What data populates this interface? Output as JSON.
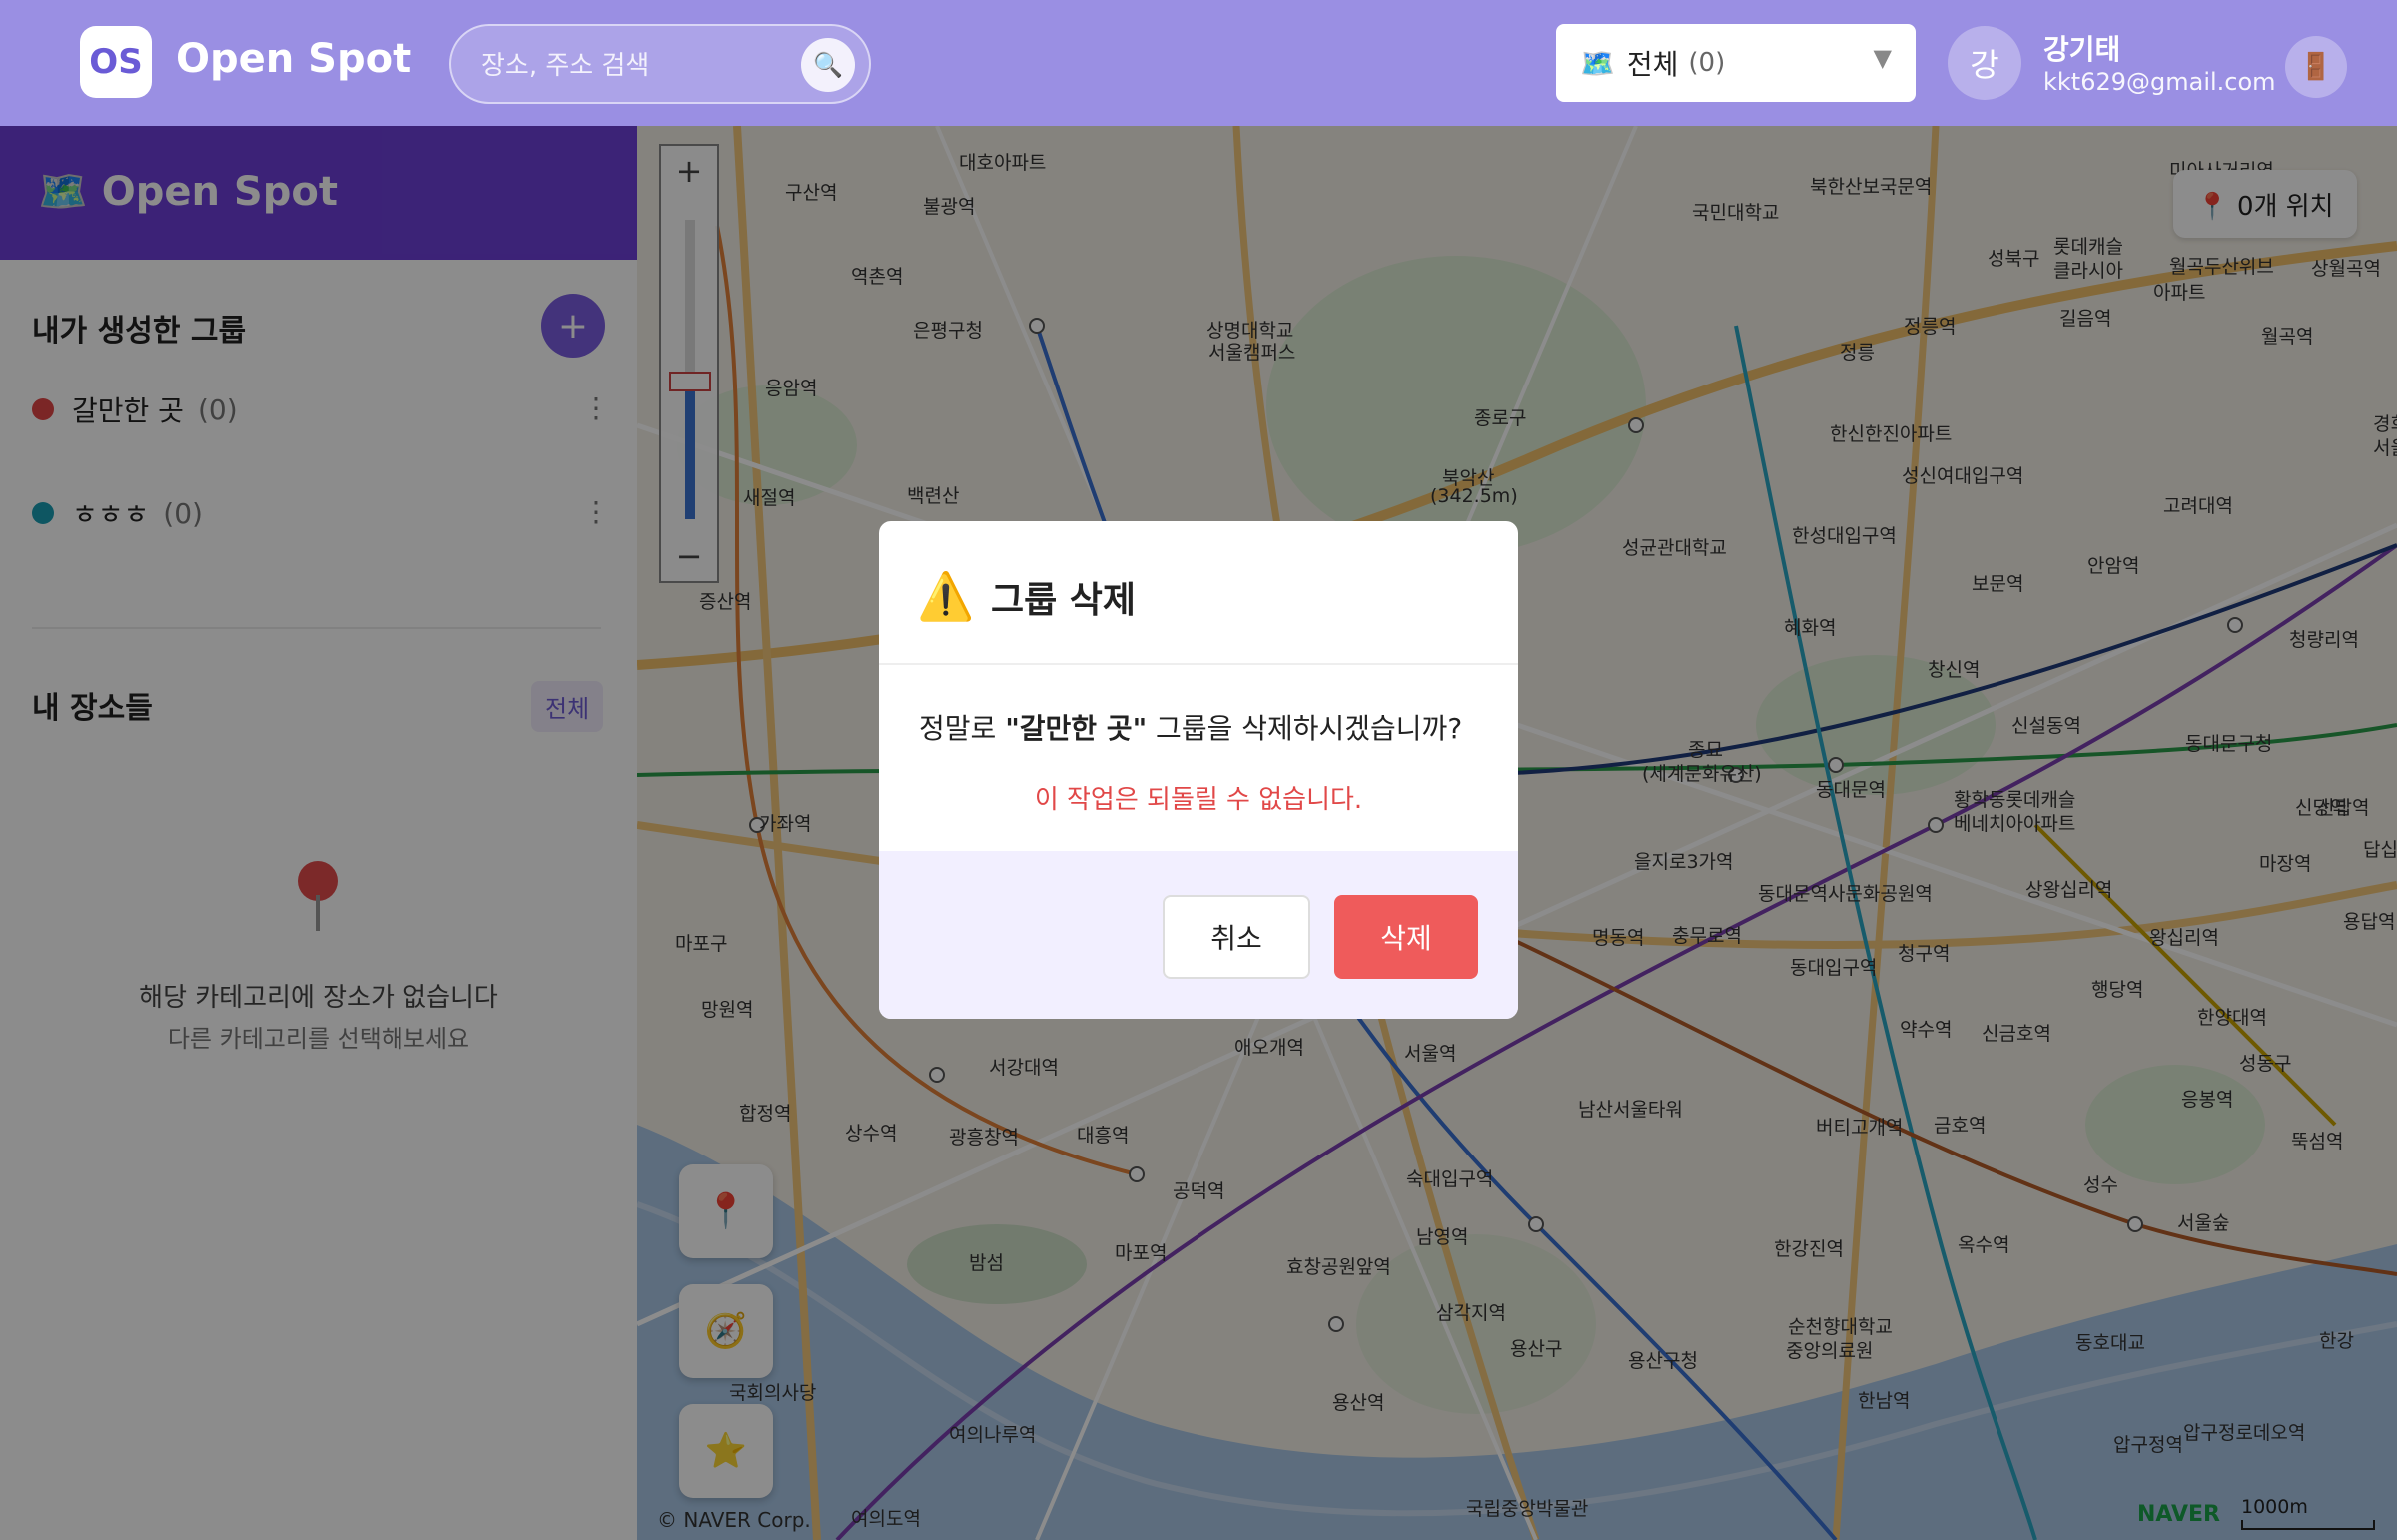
{
  "header": {
    "logo_badge": "OS",
    "app_name": "Open Spot",
    "search_placeholder": "장소, 주소 검색",
    "search_icon": "🔍",
    "category": {
      "icon": "🗺️",
      "label": "전체",
      "count": "(0)",
      "caret": "▼"
    },
    "user": {
      "avatar_initial": "강",
      "name": "강기태",
      "email": "kkt629@gmail.com"
    },
    "logout_icon": "🚪"
  },
  "sidebar": {
    "brand": "🗺️ Open Spot",
    "my_groups_title": "내가 생성한 그룹",
    "add_group_label": "+",
    "groups": [
      {
        "name": "갈만한 곳",
        "count": "(0)",
        "color": "#e04545",
        "menu": "⋮"
      },
      {
        "name": "ㅎㅎㅎ",
        "count": "(0)",
        "color": "#1a9db2",
        "menu": "⋮"
      }
    ],
    "my_places_title": "내 장소들",
    "all_badge": "전체",
    "empty_main": "해당 카테고리에 장소가 없습니다",
    "empty_sub": "다른 카테고리를 선택해보세요"
  },
  "map": {
    "zoom_in": "+",
    "zoom_out": "−",
    "location_count": "📍 0개 위치",
    "fab_pin": "📍",
    "fab_compass": "🧭",
    "fab_star": "⭐",
    "naver": "NAVER",
    "scale": "1000m",
    "copyright": "© NAVER Corp.",
    "labels": [
      {
        "t": "구산역"
      },
      {
        "t": "불광역"
      },
      {
        "t": "역촌역"
      },
      {
        "t": "은평구청"
      },
      {
        "t": "응암역"
      },
      {
        "t": "새절역"
      },
      {
        "t": "증산역"
      },
      {
        "t": "가좌역"
      },
      {
        "t": "마포구"
      },
      {
        "t": "망원역"
      },
      {
        "t": "합정역"
      },
      {
        "t": "상수역"
      },
      {
        "t": "광흥창역"
      },
      {
        "t": "대흥역"
      },
      {
        "t": "서강대역"
      },
      {
        "t": "애오개역"
      },
      {
        "t": "서울역"
      },
      {
        "t": "공덕역"
      },
      {
        "t": "마포역"
      },
      {
        "t": "밤섬"
      },
      {
        "t": "효창공원앞역"
      },
      {
        "t": "숙대입구역"
      },
      {
        "t": "남영역"
      },
      {
        "t": "삼각지역"
      },
      {
        "t": "용산구"
      },
      {
        "t": "용산구청"
      },
      {
        "t": "용산역"
      },
      {
        "t": "국회의사당"
      },
      {
        "t": "여의나루역"
      },
      {
        "t": "여의도역"
      },
      {
        "t": "국립중앙박물관"
      },
      {
        "t": "남산서울타워"
      },
      {
        "t": "을지로3가역"
      },
      {
        "t": "명동역"
      },
      {
        "t": "충무로역"
      },
      {
        "t": "동대입구역"
      },
      {
        "t": "약수역"
      },
      {
        "t": "버티고개역"
      },
      {
        "t": "금호역"
      },
      {
        "t": "옥수역"
      },
      {
        "t": "한강진역"
      },
      {
        "t": "한남역"
      },
      {
        "t": "압구정역"
      },
      {
        "t": "종로구"
      },
      {
        "t": "북악산"
      },
      {
        "t": "(342.5m)"
      },
      {
        "t": "백련산"
      },
      {
        "t": "상명대학교"
      },
      {
        "t": "서울캠퍼스"
      },
      {
        "t": "국민대학교"
      },
      {
        "t": "북한산보국문역"
      },
      {
        "t": "정릉역"
      },
      {
        "t": "성북구"
      },
      {
        "t": "롯데캐슬"
      },
      {
        "t": "클라시아"
      },
      {
        "t": "길음역"
      },
      {
        "t": "미아사거리역"
      },
      {
        "t": "월곡두산위브"
      },
      {
        "t": "아파트"
      },
      {
        "t": "상월곡역"
      },
      {
        "t": "월곡역"
      },
      {
        "t": "한신한진아파트"
      },
      {
        "t": "성신여대입구역"
      },
      {
        "t": "한성대입구역"
      },
      {
        "t": "성균관대학교"
      },
      {
        "t": "보문역"
      },
      {
        "t": "안암역"
      },
      {
        "t": "고려대역"
      },
      {
        "t": "혜화역"
      },
      {
        "t": "창신역"
      },
      {
        "t": "신설동역"
      },
      {
        "t": "종묘"
      },
      {
        "t": "(세계문화유산)"
      },
      {
        "t": "동대문역"
      },
      {
        "t": "황학동롯데캐슬"
      },
      {
        "t": "베네치아아파트"
      },
      {
        "t": "동대문역사문화공원역"
      },
      {
        "t": "상왕십리역"
      },
      {
        "t": "왕십리역"
      },
      {
        "t": "청구역"
      },
      {
        "t": "신당역"
      },
      {
        "t": "행당역"
      },
      {
        "t": "신금호역"
      },
      {
        "t": "마장역"
      },
      {
        "t": "한양대역"
      },
      {
        "t": "성동구"
      },
      {
        "t": "응봉역"
      },
      {
        "t": "뚝섬역"
      },
      {
        "t": "서울숲"
      },
      {
        "t": "성수"
      },
      {
        "t": "동대문구청"
      },
      {
        "t": "청량리역"
      },
      {
        "t": "경희대"
      },
      {
        "t": "서울캠"
      },
      {
        "t": "순천향대학교"
      },
      {
        "t": "중앙의료원"
      },
      {
        "t": "동호대교"
      },
      {
        "t": "압구정로데오역"
      },
      {
        "t": "한강"
      },
      {
        "t": "신답역"
      },
      {
        "t": "답십"
      },
      {
        "t": "용답역"
      },
      {
        "t": "대호아파트"
      },
      {
        "t": "정릉"
      }
    ]
  },
  "modal": {
    "warn_icon": "⚠️",
    "title": "그룹 삭제",
    "msg_prefix": "정말로 ",
    "msg_group": "\"갈만한 곳\"",
    "msg_suffix": " 그룹을 삭제하시겠습니까?",
    "warning": "이 작업은 되돌릴 수 없습니다.",
    "cancel": "취소",
    "delete": "삭제"
  }
}
